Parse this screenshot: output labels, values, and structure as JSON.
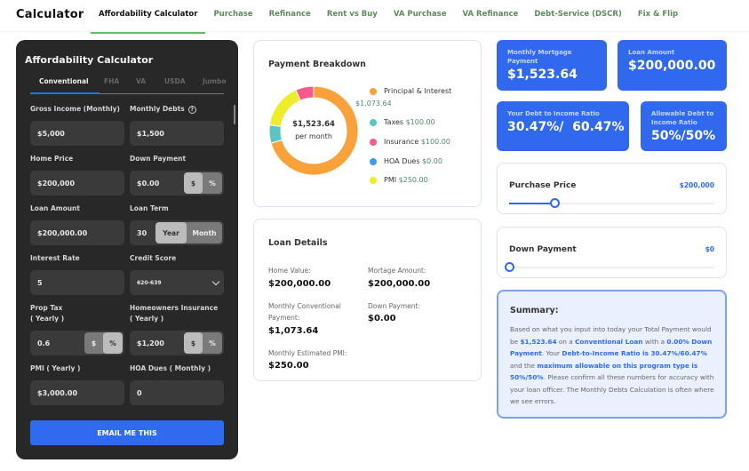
{
  "nav": {
    "brand": "Calculator",
    "tabs": [
      {
        "label": "Affordability Calculator",
        "active": true
      },
      {
        "label": "Purchase"
      },
      {
        "label": "Refinance"
      },
      {
        "label": "Rent vs Buy"
      },
      {
        "label": "VA Purchase"
      },
      {
        "label": "VA Refinance"
      },
      {
        "label": "Debt-Service (DSCR)"
      },
      {
        "label": "Fix & Flip"
      }
    ]
  },
  "calculator": {
    "title": "Affordability Calculator",
    "loan_tabs": [
      "Conventional",
      "FHA",
      "VA",
      "USDA",
      "Jumbo"
    ],
    "active_loan_tab": "Conventional",
    "fields": {
      "gross_income": {
        "label": "Gross Income (Monthly)",
        "value": "$5,000"
      },
      "monthly_debts": {
        "label": "Monthly Debts",
        "value": "$1,500",
        "help_icon": "question-circle-icon"
      },
      "home_price": {
        "label": "Home Price",
        "value": "$200,000"
      },
      "down_payment": {
        "label": "Down Payment",
        "value": "$0.00",
        "units": [
          "$",
          "%"
        ],
        "selected_unit": "$"
      },
      "loan_amount": {
        "label": "Loan Amount",
        "value": "$200,000.00"
      },
      "loan_term": {
        "label": "Loan Term",
        "value": "30",
        "units": [
          "Year",
          "Month"
        ],
        "selected_unit": "Year"
      },
      "interest_rate": {
        "label": "Interest Rate",
        "value": "5"
      },
      "credit_score": {
        "label": "Credit Score",
        "value": "620-639"
      },
      "prop_tax": {
        "label": "Prop Tax",
        "label2": "( Yearly )",
        "value": "0.6",
        "units": [
          "$",
          "%"
        ],
        "selected_unit": "%"
      },
      "home_insurance": {
        "label": "Homeowners Insurance",
        "label2": "( Yearly )",
        "value": "$1,200",
        "units": [
          "$",
          "%"
        ],
        "selected_unit": "$"
      },
      "pmi": {
        "label": "PMI ( Yearly )",
        "value": "$3,000.00"
      },
      "hoa": {
        "label": "HOA Dues ( Monthly )",
        "value": "0"
      }
    },
    "email_button": "EMAIL ME THIS"
  },
  "breakdown": {
    "title": "Payment Breakdown",
    "total": "$1,523.64",
    "total_sub": "per month"
  },
  "chart_data": {
    "type": "pie",
    "title": "Payment Breakdown",
    "donut": true,
    "center_label": "$1,523.64 per month",
    "slices": [
      {
        "name": "Principal & Interest",
        "value": 1073.64,
        "display": "$1,073.64",
        "color": "#f9a13a"
      },
      {
        "name": "Taxes",
        "value": 100.0,
        "display": "$100.00",
        "color": "#5bc5c2"
      },
      {
        "name": "Insurance",
        "value": 100.0,
        "display": "$100.00",
        "color": "#f75b8c"
      },
      {
        "name": "HOA Dues",
        "value": 0.0,
        "display": "$0.00",
        "color": "#3d9cf0"
      },
      {
        "name": "PMI",
        "value": 250.0,
        "display": "$250.00",
        "color": "#eded2a"
      }
    ],
    "draw_order": [
      "Principal & Interest",
      "Taxes",
      "PMI",
      "HOA Dues",
      "Insurance"
    ],
    "legend": "right"
  },
  "loan_details": {
    "title": "Loan Details",
    "items": [
      {
        "label": "Home Value:",
        "value": "$200,000.00"
      },
      {
        "label": "Mortage Amount:",
        "value": "$200,000.00"
      },
      {
        "label": "Monthly Conventional Payment:",
        "value": "$1,073.64"
      },
      {
        "label": "Down Payment:",
        "value": "$0.00"
      },
      {
        "label": "Monthly Estimated PMI:",
        "value": "$250.00"
      }
    ]
  },
  "stats": {
    "monthly_payment": {
      "label": "Monthly Mortgage Payment",
      "value": "$1,523.64"
    },
    "loan_amount": {
      "label": "Loan Amount",
      "value": "$200,000.00"
    },
    "dti": {
      "label": "Your Debt to Income Ratio",
      "value": "30.47%/  60.47%"
    },
    "allowable_dti": {
      "label": "Allowable Debt to Income Ratio",
      "value": "50%/50%"
    }
  },
  "sliders": {
    "purchase_price": {
      "label": "Purchase Price",
      "value": "$200,000",
      "fraction": 0.22
    },
    "down_payment": {
      "label": "Down Payment",
      "value": "$0",
      "fraction": 0.0
    }
  },
  "summary": {
    "title": "Summary:",
    "t1": "Based on what you input into today your Total Payment would be ",
    "b1": "$1,523.64",
    "t2": " on a ",
    "b2": "Conventional Loan",
    "t3": " with a ",
    "b3": "0.00% Down Payment",
    "t4": ". Your ",
    "b4": "Debt-to-Income Ratio is 30.47%/60.47%",
    "t5": " and the ",
    "b5": "maximum allowable on this program type is 50%/50%",
    "t6": ". Please confirm all these numbers for accuracy with your loan officer. The Monthly Debts Calculation is often where we see errors."
  },
  "colors": {
    "accent": "#3169ee",
    "nav_active_underline": "#5cc06a",
    "panel_bg": "#282828"
  }
}
